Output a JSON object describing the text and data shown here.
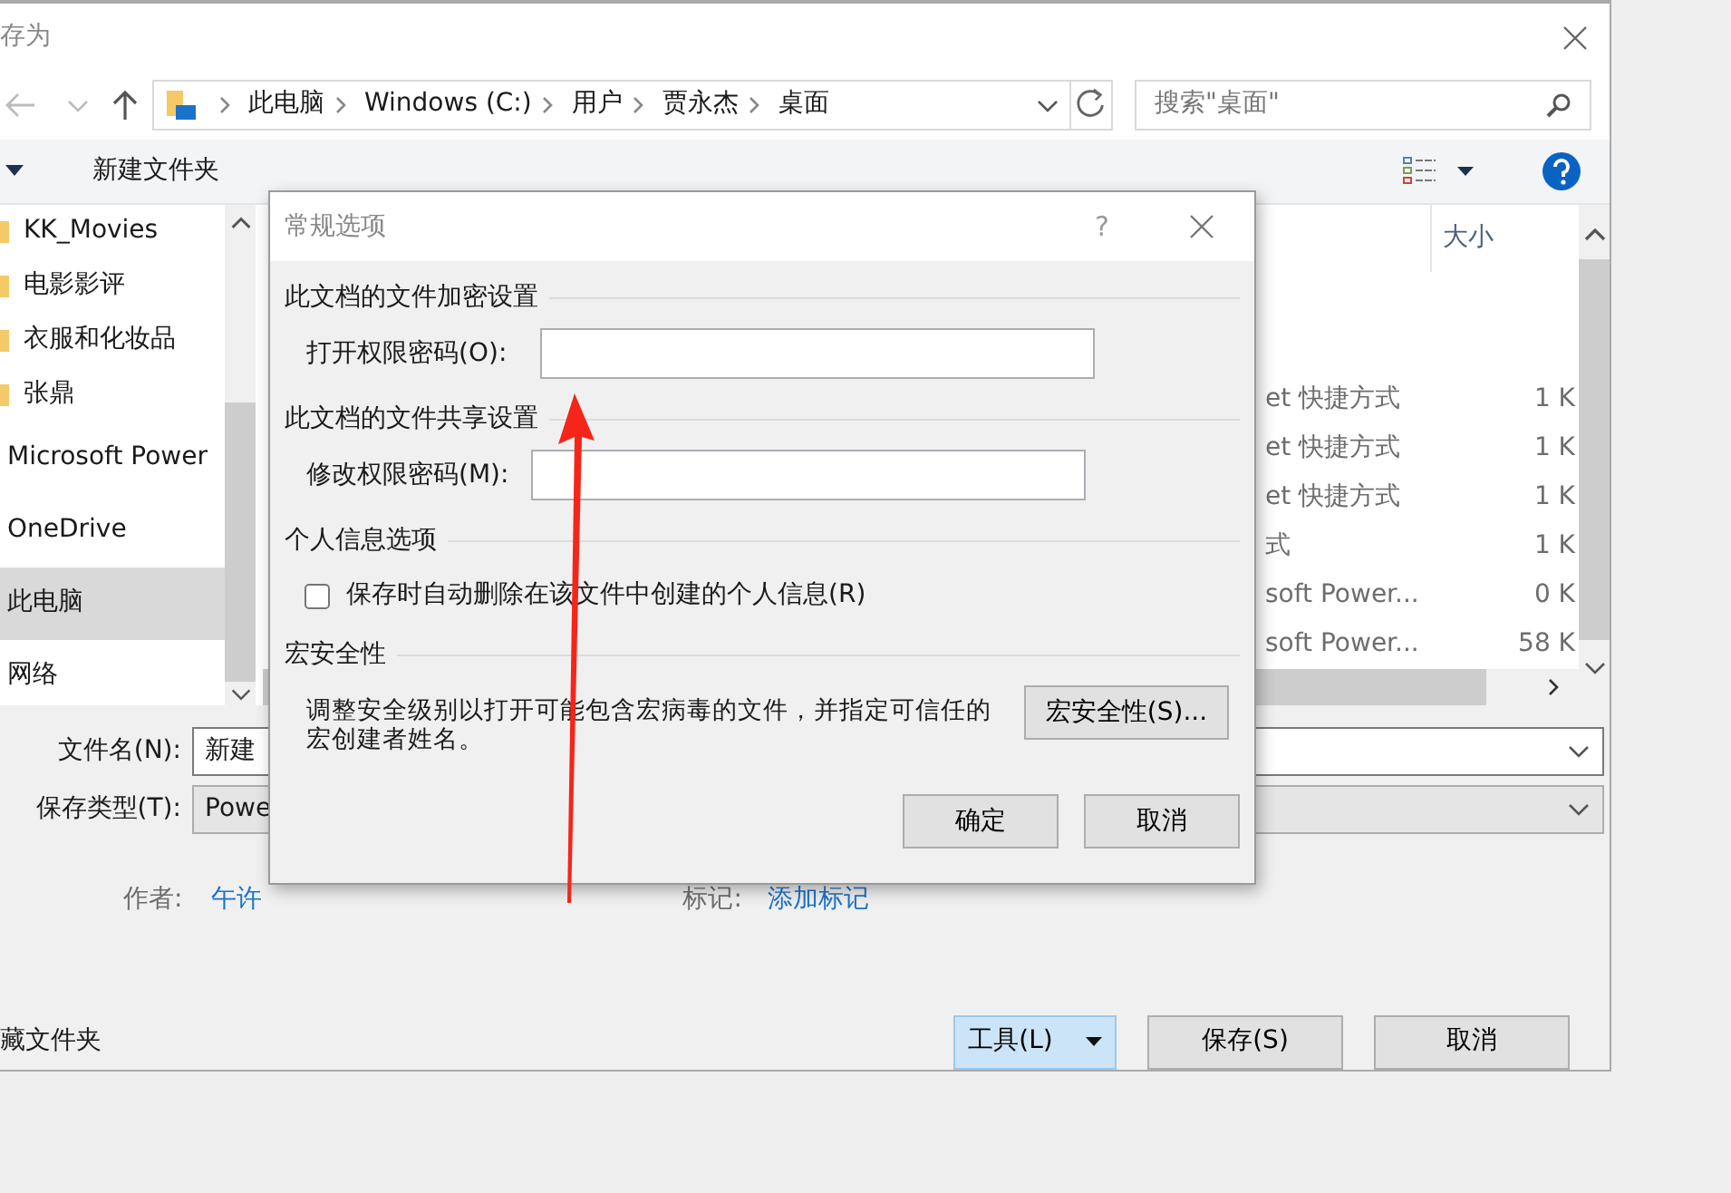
{
  "window": {
    "title": "存为"
  },
  "address": {
    "crumbs": [
      "此电脑",
      "Windows (C:)",
      "用户",
      "贾永杰",
      "桌面"
    ]
  },
  "search": {
    "placeholder": "搜索\"桌面\""
  },
  "toolbar": {
    "new_folder": "新建文件夹"
  },
  "sidebar": {
    "items": [
      {
        "label": "KK_Movies",
        "kind": "folder",
        "selected": false
      },
      {
        "label": "电影影评",
        "kind": "folder",
        "selected": false
      },
      {
        "label": "衣服和化妆品",
        "kind": "folder",
        "selected": false
      },
      {
        "label": "张鼎",
        "kind": "folder",
        "selected": false
      },
      {
        "label": "Microsoft Power",
        "kind": "place",
        "selected": false
      },
      {
        "label": "OneDrive",
        "kind": "place",
        "selected": false
      },
      {
        "label": "此电脑",
        "kind": "place",
        "selected": true
      },
      {
        "label": "网络",
        "kind": "place",
        "selected": false
      }
    ]
  },
  "file_list": {
    "columns": [
      "大小"
    ],
    "rows": [
      {
        "name": "et 快捷方式",
        "size": "1 K"
      },
      {
        "name": "et 快捷方式",
        "size": "1 K"
      },
      {
        "name": "et 快捷方式",
        "size": "1 K"
      },
      {
        "name": "式",
        "size": "1 K"
      },
      {
        "name": "soft Power...",
        "size": "0 K"
      },
      {
        "name": "soft Power...",
        "size": "58 K"
      }
    ]
  },
  "form": {
    "file_name": {
      "label": "文件名(N):",
      "value": "新建"
    },
    "save_type": {
      "label": "保存类型(T):",
      "value": "Powe"
    },
    "author_label": "作者:",
    "author": "午许",
    "tags_label": "标记:",
    "tags": "添加标记"
  },
  "footer": {
    "hide_folders": "藏文件夹",
    "buttons": [
      {
        "label": "工具(L)",
        "kind": "menu"
      },
      {
        "label": "保存(S)",
        "kind": "plain"
      },
      {
        "label": "取消",
        "kind": "plain"
      }
    ]
  },
  "dialog": {
    "title": "常规选项",
    "help": "?",
    "sections": [
      {
        "title": "此文档的文件加密设置",
        "kind": "field",
        "label": "打开权限密码(O):"
      },
      {
        "title": "此文档的文件共享设置",
        "kind": "field",
        "label": "修改权限密码(M):"
      },
      {
        "title": "个人信息选项",
        "kind": "checkbox",
        "label": "保存时自动删除在该文件中创建的个人信息(R)",
        "checked": false
      },
      {
        "title": "宏安全性",
        "kind": "text",
        "text": "调整安全级别以打开可能包含宏病毒的文件，并指定可信任的宏创建者姓名。",
        "button": "宏安全性(S)..."
      }
    ],
    "buttons": [
      "确定",
      "取消"
    ]
  }
}
